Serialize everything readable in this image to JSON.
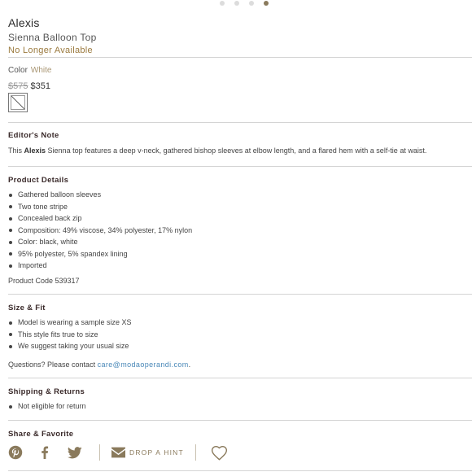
{
  "gallery": {
    "count": 4,
    "active_index": 3
  },
  "product": {
    "designer": "Alexis",
    "name": "Sienna Balloon Top",
    "availability": "No Longer Available",
    "color_label": "Color",
    "color_value": "White",
    "price_original": "$575",
    "price_sale": "$351"
  },
  "editors_note": {
    "title": "Editor's Note",
    "text_prefix": "This ",
    "text_brand": "Alexis",
    "text_suffix": " Sienna top features a deep v-neck, gathered bishop sleeves at elbow length, and a flared hem with a self-tie at waist."
  },
  "product_details": {
    "title": "Product Details",
    "items": [
      "Gathered balloon sleeves",
      "Two tone stripe",
      "Concealed back zip",
      "Composition: 49% viscose, 34% polyester, 17% nylon",
      "Color: black, white",
      "95% polyester, 5% spandex lining",
      "Imported"
    ],
    "product_code": "Product Code 539317"
  },
  "size_fit": {
    "title": "Size & Fit",
    "items": [
      "Model is wearing a sample size XS",
      "This style fits true to size",
      "We suggest taking your usual size"
    ],
    "contact_prefix": "Questions? Please contact ",
    "contact_email": "care@modaoperandi.com",
    "contact_suffix": "."
  },
  "shipping": {
    "title": "Shipping & Returns",
    "items": [
      "Not eligible for return"
    ]
  },
  "share": {
    "title": "Share & Favorite",
    "hint_label": "DROP A HINT",
    "icons": [
      "pinterest-icon",
      "facebook-icon",
      "twitter-icon",
      "envelope-icon",
      "heart-icon"
    ]
  },
  "colors": {
    "accent_gold": "#9b7a3e",
    "link_blue": "#4a88b8",
    "divider": "#d4d4d4"
  }
}
